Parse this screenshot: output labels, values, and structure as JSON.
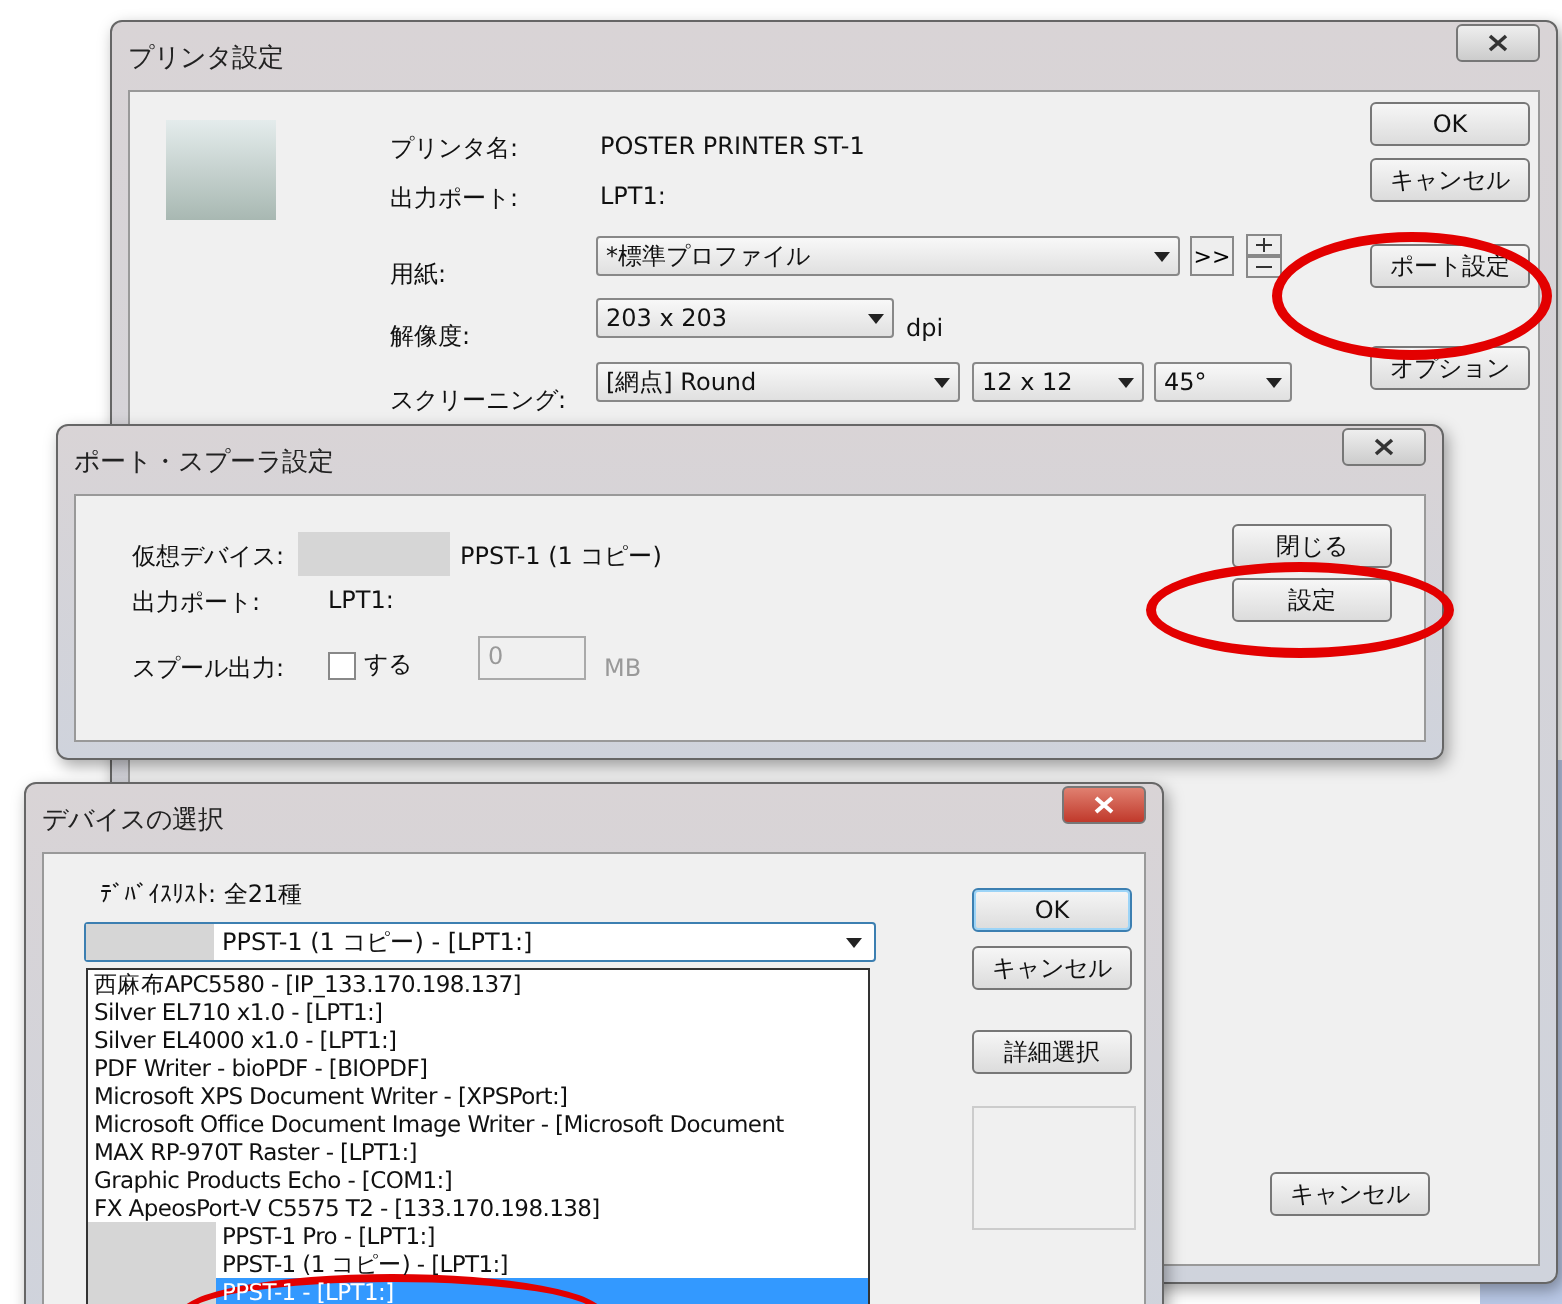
{
  "printer_window": {
    "title": "プリンタ設定",
    "fields": [
      {
        "label": "プリンタ名:",
        "value": "POSTER PRINTER ST-1"
      },
      {
        "label": "出力ポート:",
        "value": "LPT1:"
      }
    ],
    "paper": {
      "label": "用紙:",
      "value": "*標準プロファイル",
      "more": ">>"
    },
    "resolution": {
      "label": "解像度:",
      "value": "203 x 203",
      "unit": "dpi"
    },
    "screening": {
      "label": "スクリーニング:",
      "values": [
        "[網点] Round",
        "12 x 12",
        "45°"
      ]
    },
    "buttons": [
      "OK",
      "キャンセル",
      "ポート設定",
      "オプション"
    ],
    "footer_button": "キャンセル"
  },
  "port_window": {
    "title": "ポート・スプーラ設定",
    "device": {
      "label": "仮想デバイス:",
      "value": "PPST-1 (1 コピー)"
    },
    "port": {
      "label": "出力ポート:",
      "value": "LPT1:"
    },
    "spool": {
      "label": "スプール出力:",
      "checkbox": "する",
      "checked": false,
      "size": "0",
      "unit": "MB",
      "disabled": true
    },
    "buttons": [
      "閉じる",
      "設定"
    ]
  },
  "device_window": {
    "title": "デバイスの選択",
    "list_label": "ﾃﾞﾊﾞｲｽﾘｽﾄ: 全21種",
    "combo_value": "PPST-1 (1 コピー) - [LPT1:]",
    "items": [
      {
        "label": "西麻布APC5580 - [IP_133.170.198.137]",
        "selected": false
      },
      {
        "label": "Silver EL710 x1.0 - [LPT1:]",
        "selected": false
      },
      {
        "label": "Silver EL4000 x1.0 - [LPT1:]",
        "selected": false
      },
      {
        "label": "PDF Writer - bioPDF - [BIOPDF]",
        "selected": false
      },
      {
        "label": "Microsoft XPS Document Writer - [XPSPort:]",
        "selected": false
      },
      {
        "label": "Microsoft Office Document Image Writer - [Microsoft Document",
        "selected": false
      },
      {
        "label": "MAX RP-970T Raster - [LPT1:]",
        "selected": false
      },
      {
        "label": "Graphic Products Echo - [COM1:]",
        "selected": false
      },
      {
        "label": "FX ApeosPort-V C5575 T2 - [133.170.198.138]",
        "selected": false
      },
      {
        "label": "PPST-1 Pro - [LPT1:]",
        "selected": false,
        "redacted": true
      },
      {
        "label": "PPST-1 (1 コピー) - [LPT1:]",
        "selected": false,
        "redacted": true
      },
      {
        "label": "PPST-1 - [LPT1:]",
        "selected": true,
        "redacted": true
      }
    ],
    "buttons": [
      "OK",
      "キャンセル",
      "詳細選択"
    ]
  }
}
